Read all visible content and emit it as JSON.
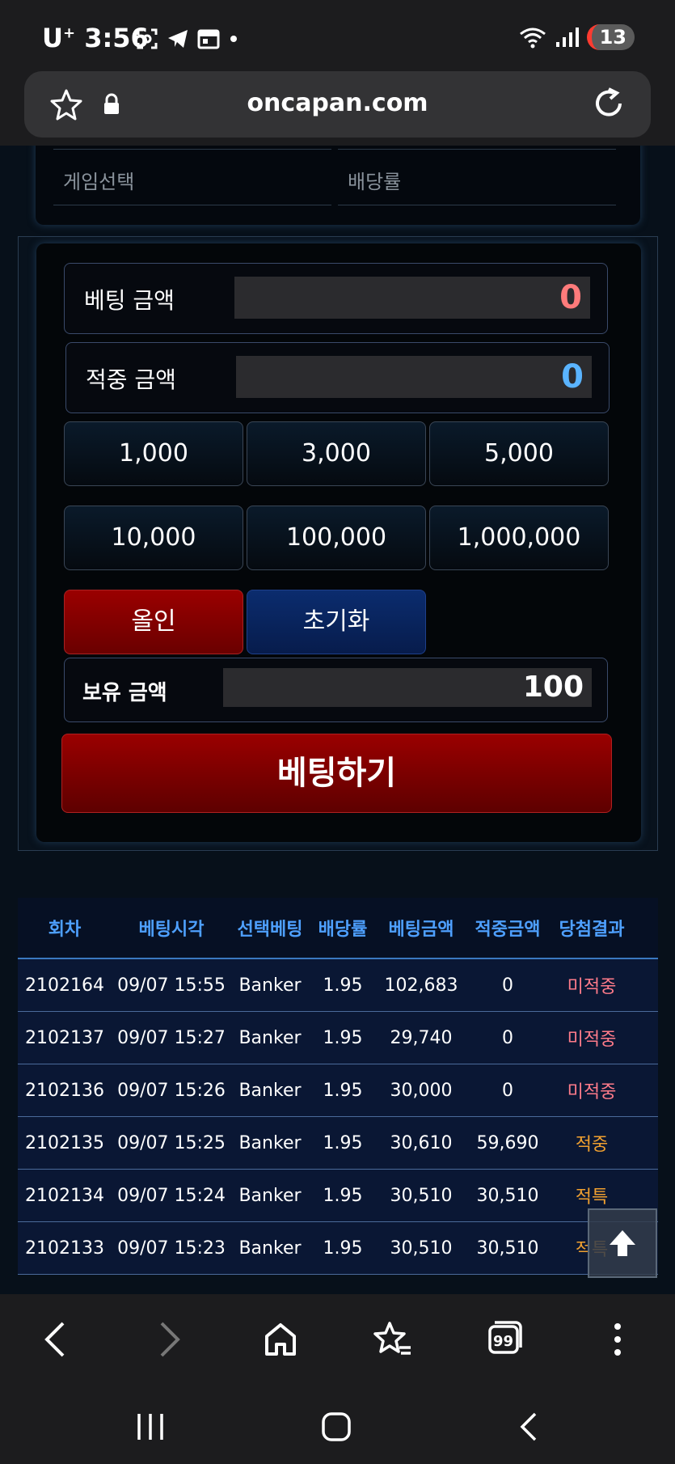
{
  "status_bar": {
    "carrier": "U",
    "time": "3:56",
    "battery": "13"
  },
  "browser": {
    "url": "oncapan.com"
  },
  "top_card": {
    "game_select_label": "게임선택",
    "odds_label": "배당률"
  },
  "bet_panel": {
    "bet_amount_label": "베팅 금액",
    "bet_amount_value": "0",
    "win_amount_label": "적중 금액",
    "win_amount_value": "0",
    "chips": [
      "1,000",
      "3,000",
      "5,000",
      "10,000",
      "100,000",
      "1,000,000"
    ],
    "allin_label": "올인",
    "reset_label": "초기화",
    "holding_label": "보유 금액",
    "holding_value": "100",
    "bet_button_label": "베팅하기",
    "colors": {
      "bet_value": "#ff7b7b",
      "win_value": "#5ab4ff"
    }
  },
  "history": {
    "headers": [
      "회차",
      "베팅시각",
      "선택베팅",
      "배당률",
      "베팅금액",
      "적중금액",
      "당첨결과"
    ],
    "rows": [
      [
        "2102164",
        "09/07 15:55",
        "Banker",
        "1.95",
        "102,683",
        "0",
        "미적중"
      ],
      [
        "2102137",
        "09/07 15:27",
        "Banker",
        "1.95",
        "29,740",
        "0",
        "미적중"
      ],
      [
        "2102136",
        "09/07 15:26",
        "Banker",
        "1.95",
        "30,000",
        "0",
        "미적중"
      ],
      [
        "2102135",
        "09/07 15:25",
        "Banker",
        "1.95",
        "30,610",
        "59,690",
        "적중"
      ],
      [
        "2102134",
        "09/07 15:24",
        "Banker",
        "1.95",
        "30,510",
        "30,510",
        "적특"
      ],
      [
        "2102133",
        "09/07 15:23",
        "Banker",
        "1.95",
        "30,510",
        "30,510",
        "적특"
      ]
    ],
    "result_colors": {
      "miss": "#ff7b8a",
      "hit": "#f0a030"
    }
  },
  "tabs_badge": "99"
}
